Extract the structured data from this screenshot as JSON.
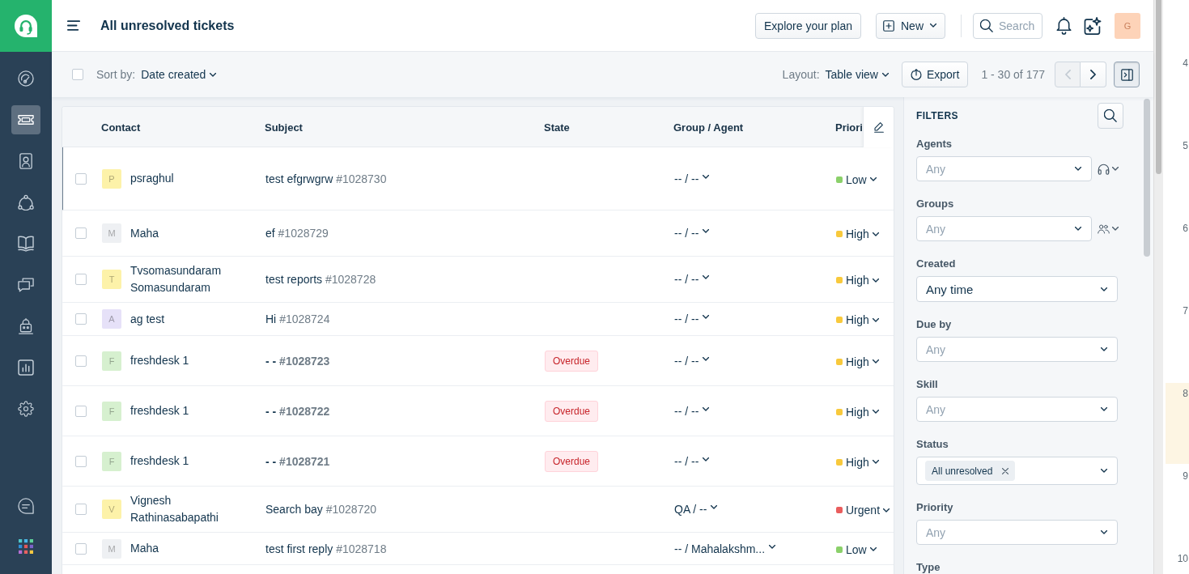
{
  "nav_items": [
    {
      "selected": false
    },
    {
      "selected": true
    },
    {
      "selected": false
    },
    {
      "selected": false
    },
    {
      "selected": false
    },
    {
      "selected": false
    },
    {
      "selected": false
    },
    {
      "selected": false
    },
    {
      "selected": false
    }
  ],
  "header": {
    "title": "All unresolved tickets",
    "buttons": [
      {
        "label": "Explore your plan",
        "kind": "plain"
      },
      {
        "label": "New",
        "kind": "menu"
      }
    ],
    "search": {
      "placeholder": "Search"
    },
    "avatar": {
      "letter": "G"
    }
  },
  "toolbar": {
    "select_all": {
      "checked": false
    },
    "sort_label": "Sort by:",
    "sort_value": "Date created",
    "layout_label": "Layout:",
    "layout_value": "Table view",
    "export": "Export",
    "range": "1 - 30 of 177",
    "prev": {
      "disabled": true
    },
    "next": {
      "disabled": false
    },
    "panel_toggle": {
      "on": true
    }
  },
  "table": {
    "columns": [
      "Contact",
      "Subject",
      "State",
      "Group / Agent",
      "Priori"
    ],
    "rows": [
      {
        "checked": false,
        "active": true,
        "avatar": {
          "letter": "P",
          "color": "#fdf2a9"
        },
        "contact": "psraghul",
        "subject": "test efgrwgrw",
        "number": "#1028730",
        "unread": false,
        "group": "-- / --",
        "priority": {
          "label": "Low",
          "color": "#8bd06a"
        }
      },
      {
        "checked": false,
        "active": false,
        "avatar": {
          "letter": "M",
          "color": "#eef0f3"
        },
        "contact": "Maha",
        "subject": "ef",
        "number": "#1028729",
        "unread": false,
        "group": "-- / --",
        "priority": {
          "label": "High",
          "color": "#f8c93c"
        }
      },
      {
        "checked": false,
        "active": false,
        "avatar": {
          "letter": "T",
          "color": "#fdf2a9"
        },
        "contact": "Tvsomasundaram Somasundaram",
        "subject": "test reports",
        "number": "#1028728",
        "unread": false,
        "group": "-- / --",
        "priority": {
          "label": "High",
          "color": "#f8c93c"
        }
      },
      {
        "checked": false,
        "active": false,
        "avatar": {
          "letter": "A",
          "color": "#e6e1f8"
        },
        "contact": "ag test",
        "subject": "Hi",
        "number": "#1028724",
        "unread": false,
        "group": "-- / --",
        "priority": {
          "label": "High",
          "color": "#f8c93c"
        }
      },
      {
        "checked": false,
        "active": false,
        "avatar": {
          "letter": "F",
          "color": "#d6f0cf"
        },
        "contact": "freshdesk 1",
        "subject": "- -",
        "number": "#1028723",
        "unread": true,
        "state": "Overdue",
        "group": "-- / --",
        "priority": {
          "label": "High",
          "color": "#f8c93c"
        }
      },
      {
        "checked": false,
        "active": false,
        "avatar": {
          "letter": "F",
          "color": "#d6f0cf"
        },
        "contact": "freshdesk 1",
        "subject": "- -",
        "number": "#1028722",
        "unread": true,
        "state": "Overdue",
        "group": "-- / --",
        "priority": {
          "label": "High",
          "color": "#f8c93c"
        }
      },
      {
        "checked": false,
        "active": false,
        "avatar": {
          "letter": "F",
          "color": "#d6f0cf"
        },
        "contact": "freshdesk 1",
        "subject": "- -",
        "number": "#1028721",
        "unread": true,
        "state": "Overdue",
        "group": "-- / --",
        "priority": {
          "label": "High",
          "color": "#f8c93c"
        }
      },
      {
        "checked": false,
        "active": false,
        "avatar": {
          "letter": "V",
          "color": "#fdf2a9"
        },
        "contact": "Vignesh Rathinasabapathi",
        "subject": "Search bay",
        "number": "#1028720",
        "unread": false,
        "group": "QA / --",
        "priority": {
          "label": "Urgent",
          "color": "#e95d5d"
        }
      },
      {
        "checked": false,
        "active": false,
        "avatar": {
          "letter": "M",
          "color": "#eef0f3"
        },
        "contact": "Maha",
        "subject": "test first reply",
        "number": "#1028718",
        "unread": false,
        "group": "-- / Mahalakshm...",
        "priority": {
          "label": "Low",
          "color": "#8bd06a"
        }
      }
    ]
  },
  "filters": {
    "title": "FILTERS",
    "fields": [
      {
        "label": "Agents",
        "kind": "agents",
        "placeholder": "Any"
      },
      {
        "label": "Groups",
        "kind": "groups",
        "placeholder": "Any"
      },
      {
        "label": "Created",
        "kind": "select",
        "value": "Any time"
      },
      {
        "label": "Due by",
        "kind": "select",
        "placeholder": "Any"
      },
      {
        "label": "Skill",
        "kind": "select",
        "placeholder": "Any"
      },
      {
        "label": "Status",
        "kind": "chips",
        "chips": [
          "All unresolved"
        ]
      },
      {
        "label": "Priority",
        "kind": "select",
        "placeholder": "Any"
      },
      {
        "label": "Type",
        "kind": "label"
      }
    ]
  },
  "side_panel": {
    "labels": [
      {
        "text": "4",
        "highlighted": false
      },
      {
        "text": "5",
        "highlighted": false
      },
      {
        "text": "6",
        "highlighted": false
      },
      {
        "text": "7",
        "highlighted": false
      },
      {
        "text": "8",
        "highlighted": true
      },
      {
        "text": "9",
        "highlighted": false
      },
      {
        "text": "10",
        "highlighted": false
      }
    ]
  }
}
